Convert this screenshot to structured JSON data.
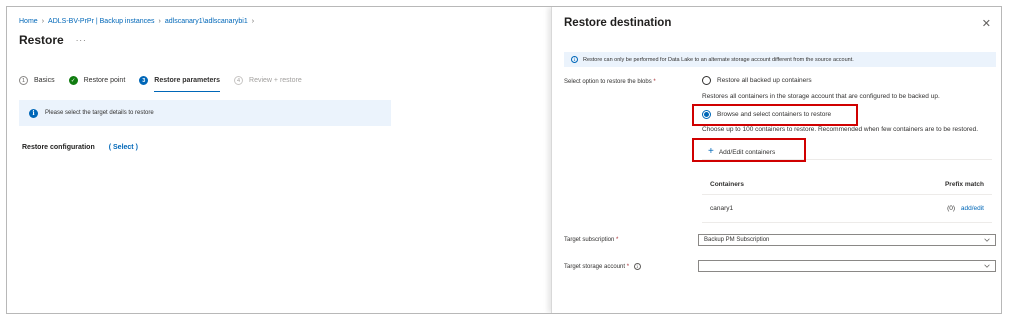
{
  "breadcrumb": {
    "items": [
      "Home",
      "ADLS-BV-PrPr | Backup instances",
      "adlscanary1\\adlscanarybi1"
    ]
  },
  "page": {
    "title": "Restore",
    "more": "···"
  },
  "steps": [
    {
      "num": "1",
      "label": "Basics",
      "state": "default"
    },
    {
      "num": "✓",
      "label": "Restore point",
      "state": "done"
    },
    {
      "num": "3",
      "label": "Restore parameters",
      "state": "current"
    },
    {
      "num": "4",
      "label": "Review + restore",
      "state": "disabled"
    }
  ],
  "left_info": {
    "text": "Please select the target details to restore",
    "icon": "info-icon"
  },
  "restore_config": {
    "label": "Restore configuration",
    "link": "( Select )"
  },
  "panel": {
    "title": "Restore destination",
    "close": "✕",
    "info": "Restore can only be performed for Data Lake to an alternate storage account different from the source account.",
    "select_option_label": "Select option to restore the blobs",
    "required": "*",
    "option_all": "Restore all backed up containers",
    "option_all_desc": "Restores all containers in the storage account that are configured to be backed up.",
    "option_browse": "Browse and select containers to restore",
    "option_browse_desc": "Choose up to 100 containers to restore. Recommended when few containers are to be restored.",
    "selected_option": "browse",
    "add_button": "Add/Edit containers",
    "table": {
      "headers": [
        "Containers",
        "Prefix match"
      ],
      "rows": [
        {
          "container": "canary1",
          "prefix_count": "(0)",
          "prefix_link": "add/edit"
        }
      ]
    },
    "target_subscription": {
      "label": "Target subscription",
      "value": "Backup PM Subscription"
    },
    "target_storage": {
      "label": "Target storage account",
      "value": ""
    }
  },
  "colors": {
    "accent": "#0067b8",
    "success": "#107c10",
    "highlight": "#d00000",
    "info_bg": "#ebf3fc"
  }
}
